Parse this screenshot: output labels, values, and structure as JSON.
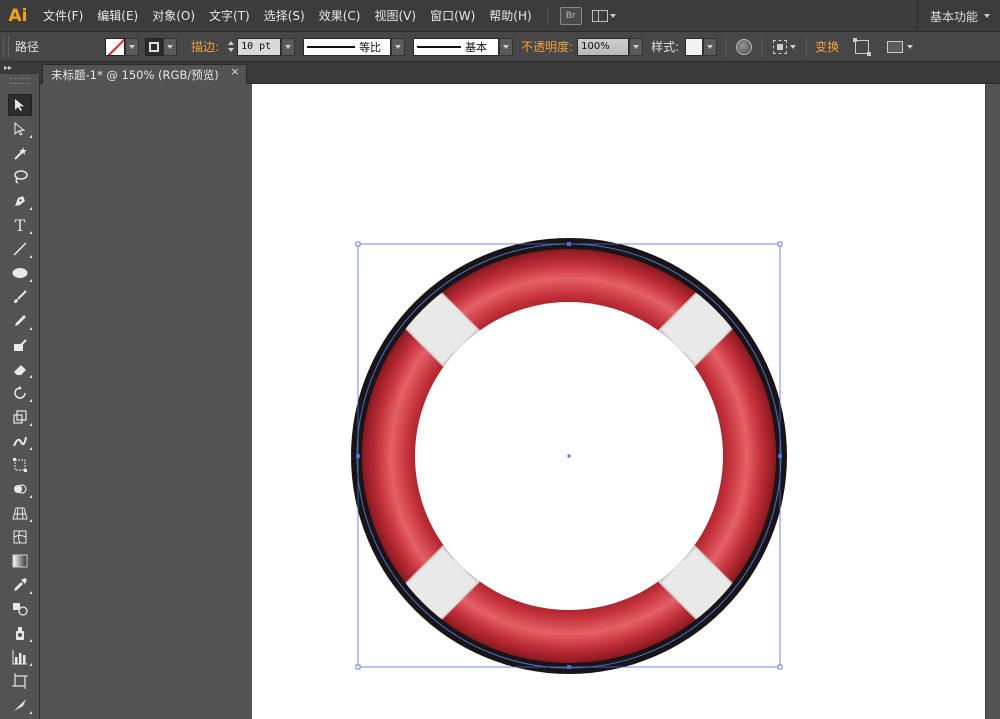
{
  "app": {
    "logo": "Ai"
  },
  "menu": [
    "文件(F)",
    "编辑(E)",
    "对象(O)",
    "文字(T)",
    "选择(S)",
    "效果(C)",
    "视图(V)",
    "窗口(W)",
    "帮助(H)"
  ],
  "bridge_label": "Br",
  "workspace": "基本功能",
  "control": {
    "object_type": "路径",
    "stroke_label": "描边:",
    "stroke_weight": "10 pt",
    "profile_label": "等比",
    "brush_label": "基本",
    "opacity_label": "不透明度:",
    "opacity_value": "100%",
    "style_label": "样式:",
    "transform_label": "变换"
  },
  "document_tab": {
    "title": "未标题-1* @ 150% (RGB/预览)",
    "close": "×"
  },
  "toolbar_header": "▸▸",
  "tools": [
    "selection-tool",
    "direct-selection-tool",
    "magic-wand-tool",
    "lasso-tool",
    "pen-tool",
    "type-tool",
    "line-segment-tool",
    "ellipse-tool",
    "paintbrush-tool",
    "pencil-tool",
    "blob-brush-tool",
    "eraser-tool",
    "rotate-tool",
    "scale-tool",
    "warp-tool",
    "free-transform-tool",
    "shape-builder-tool",
    "perspective-grid-tool",
    "mesh-tool",
    "gradient-tool",
    "eyedropper-tool",
    "blend-tool",
    "symbol-sprayer-tool",
    "column-graph-tool",
    "artboard-tool",
    "slice-tool"
  ],
  "colors": {
    "ring_red": "#c8303a",
    "ring_dark": "#8e1820",
    "ring_outline": "#1a1414",
    "band_white": "#ececec",
    "selection_blue": "#4a6fd0",
    "accent_orange": "#f0a040"
  }
}
